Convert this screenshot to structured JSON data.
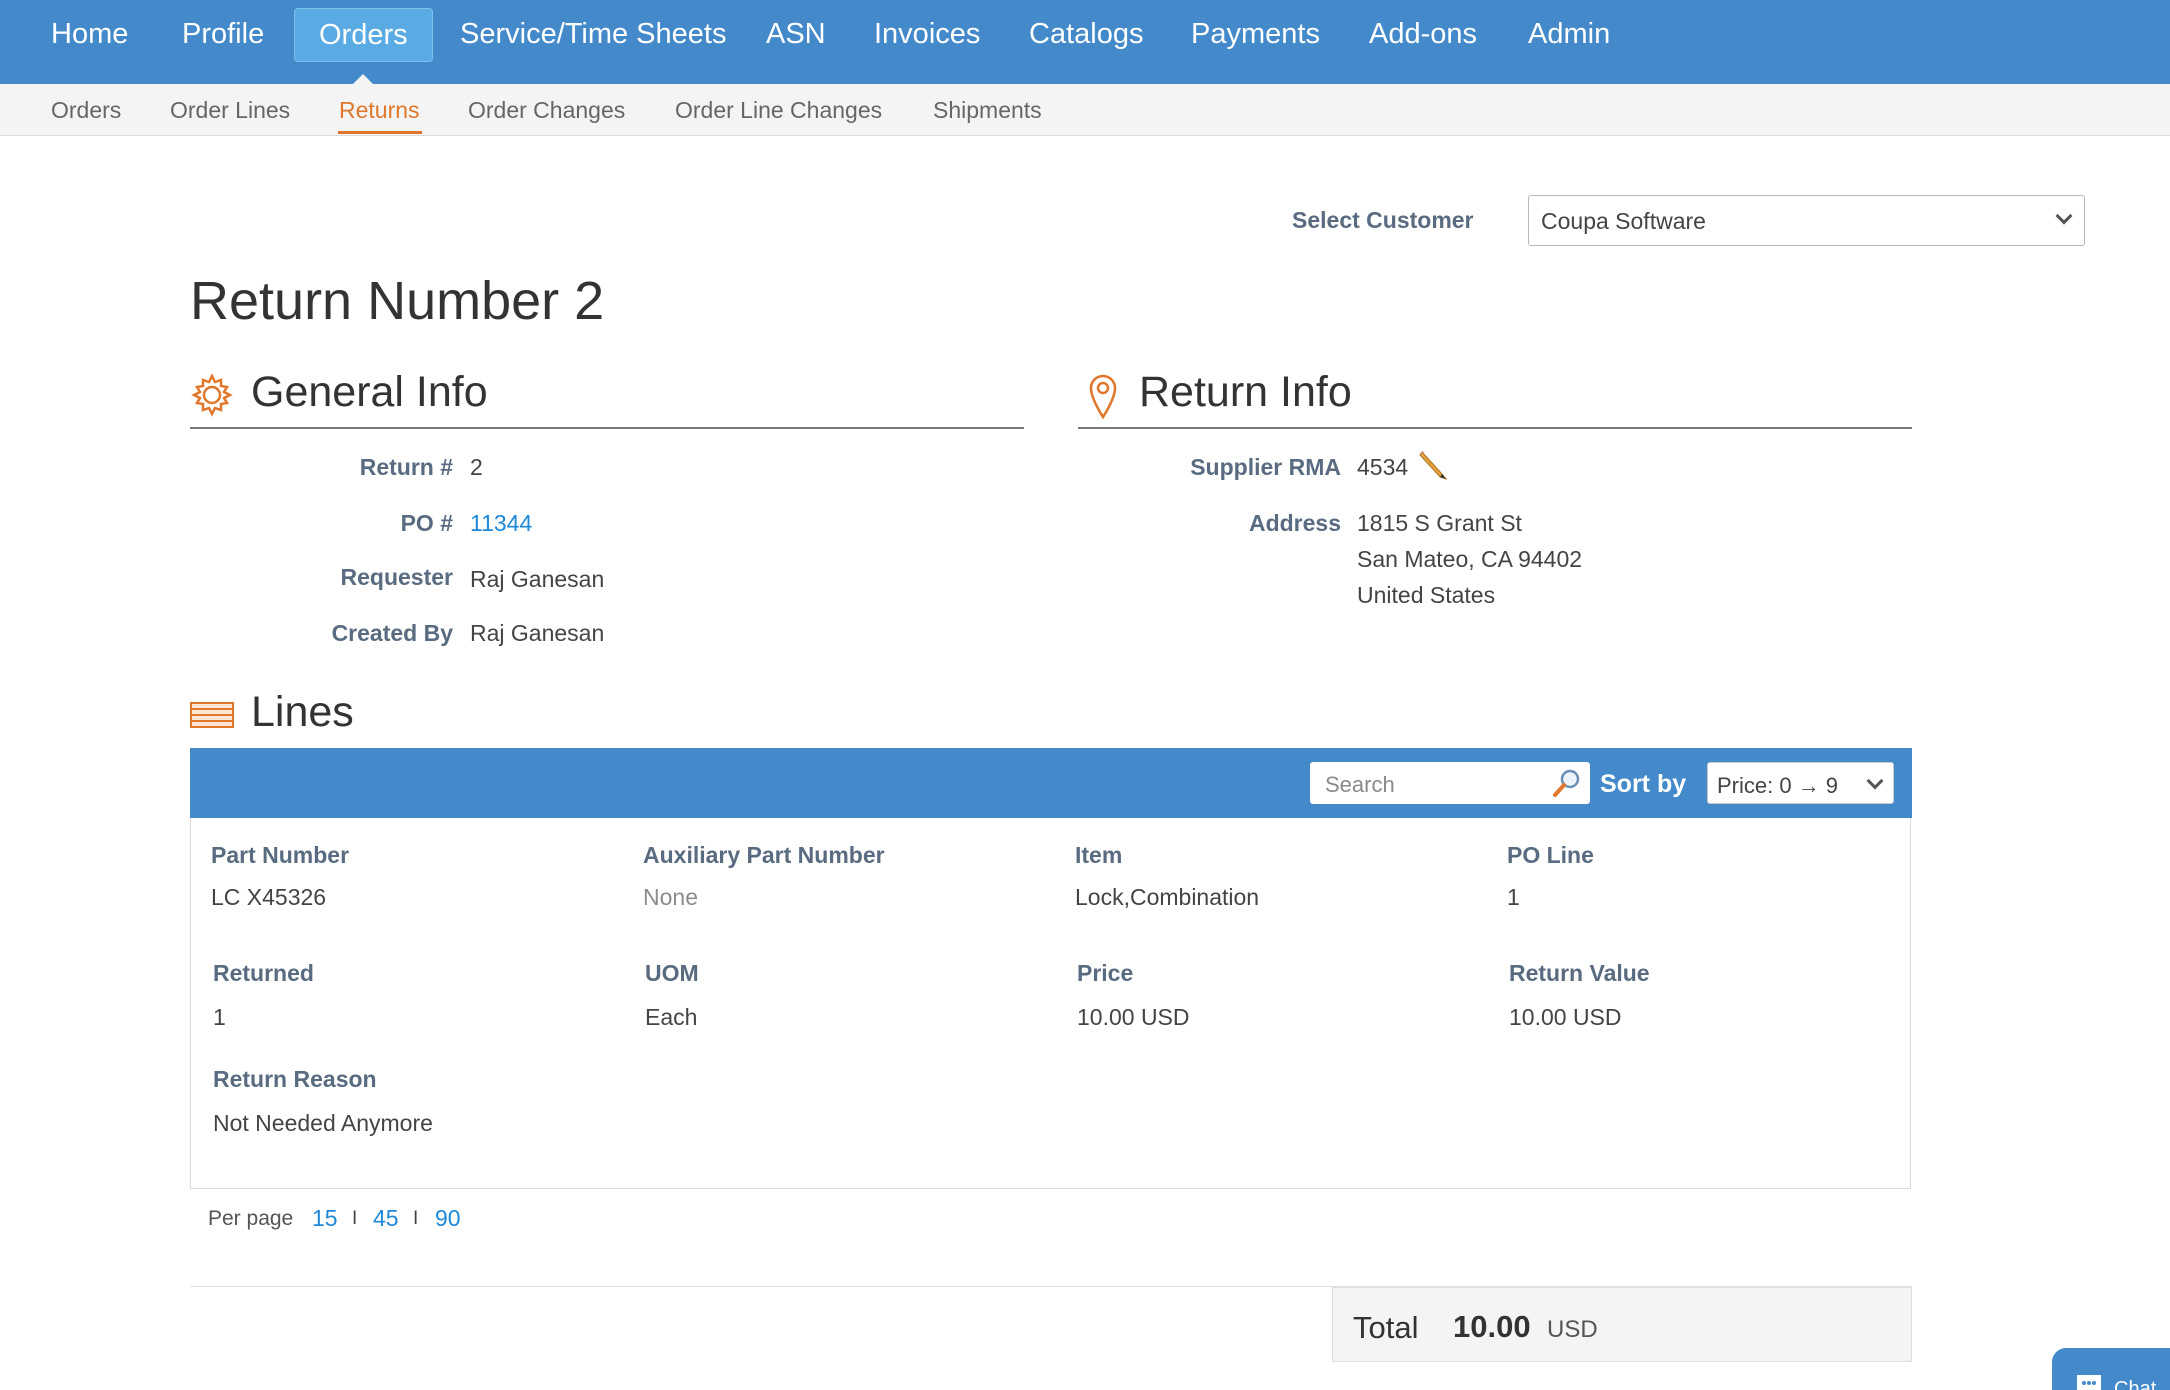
{
  "topnav": {
    "items": [
      "Home",
      "Profile",
      "Orders",
      "Service/Time Sheets",
      "ASN",
      "Invoices",
      "Catalogs",
      "Payments",
      "Add-ons",
      "Admin"
    ],
    "active": "Orders"
  },
  "subnav": {
    "items": [
      "Orders",
      "Order Lines",
      "Returns",
      "Order Changes",
      "Order Line Changes",
      "Shipments"
    ],
    "active": "Returns"
  },
  "customer": {
    "label": "Select Customer",
    "value": "Coupa Software"
  },
  "page": {
    "title": "Return Number 2"
  },
  "general": {
    "title": "General Info",
    "return_label": "Return #",
    "return_value": "2",
    "po_label": "PO #",
    "po_value": "11344",
    "requester_label": "Requester",
    "requester_value": "Raj Ganesan",
    "created_label": "Created By",
    "created_value": "Raj Ganesan"
  },
  "return_info": {
    "title": "Return Info",
    "rma_label": "Supplier RMA",
    "rma_value": "4534",
    "address_label": "Address",
    "address_lines": [
      "1815 S Grant St",
      "San Mateo, CA 94402",
      "United States"
    ]
  },
  "lines": {
    "title": "Lines",
    "search_placeholder": "Search",
    "sort_label": "Sort by",
    "sort_value": "Price: 0 → 9",
    "row": {
      "part_number_label": "Part Number",
      "part_number": "LC X45326",
      "aux_label": "Auxiliary Part Number",
      "aux": "None",
      "item_label": "Item",
      "item": "Lock,Combination",
      "po_line_label": "PO Line",
      "po_line": "1",
      "returned_label": "Returned",
      "returned": "1",
      "uom_label": "UOM",
      "uom": "Each",
      "price_label": "Price",
      "price": "10.00 USD",
      "return_value_label": "Return Value",
      "return_value": "10.00 USD",
      "reason_label": "Return Reason",
      "reason": "Not Needed Anymore"
    },
    "per_page_label": "Per page",
    "per_page_options": [
      "15",
      "45",
      "90"
    ],
    "per_page_sep": "I"
  },
  "total": {
    "label": "Total",
    "value": "10.00",
    "currency": "USD"
  },
  "chat": {
    "label": "Chat"
  },
  "colors": {
    "nav": "#448acb",
    "accent": "#e0772b",
    "link": "#1e88d8",
    "label": "#596b80"
  },
  "icons": {
    "general": "gear-icon",
    "return_info": "map-pin-icon",
    "lines": "lines-icon",
    "search": "search-icon",
    "edit": "pencil-icon"
  }
}
